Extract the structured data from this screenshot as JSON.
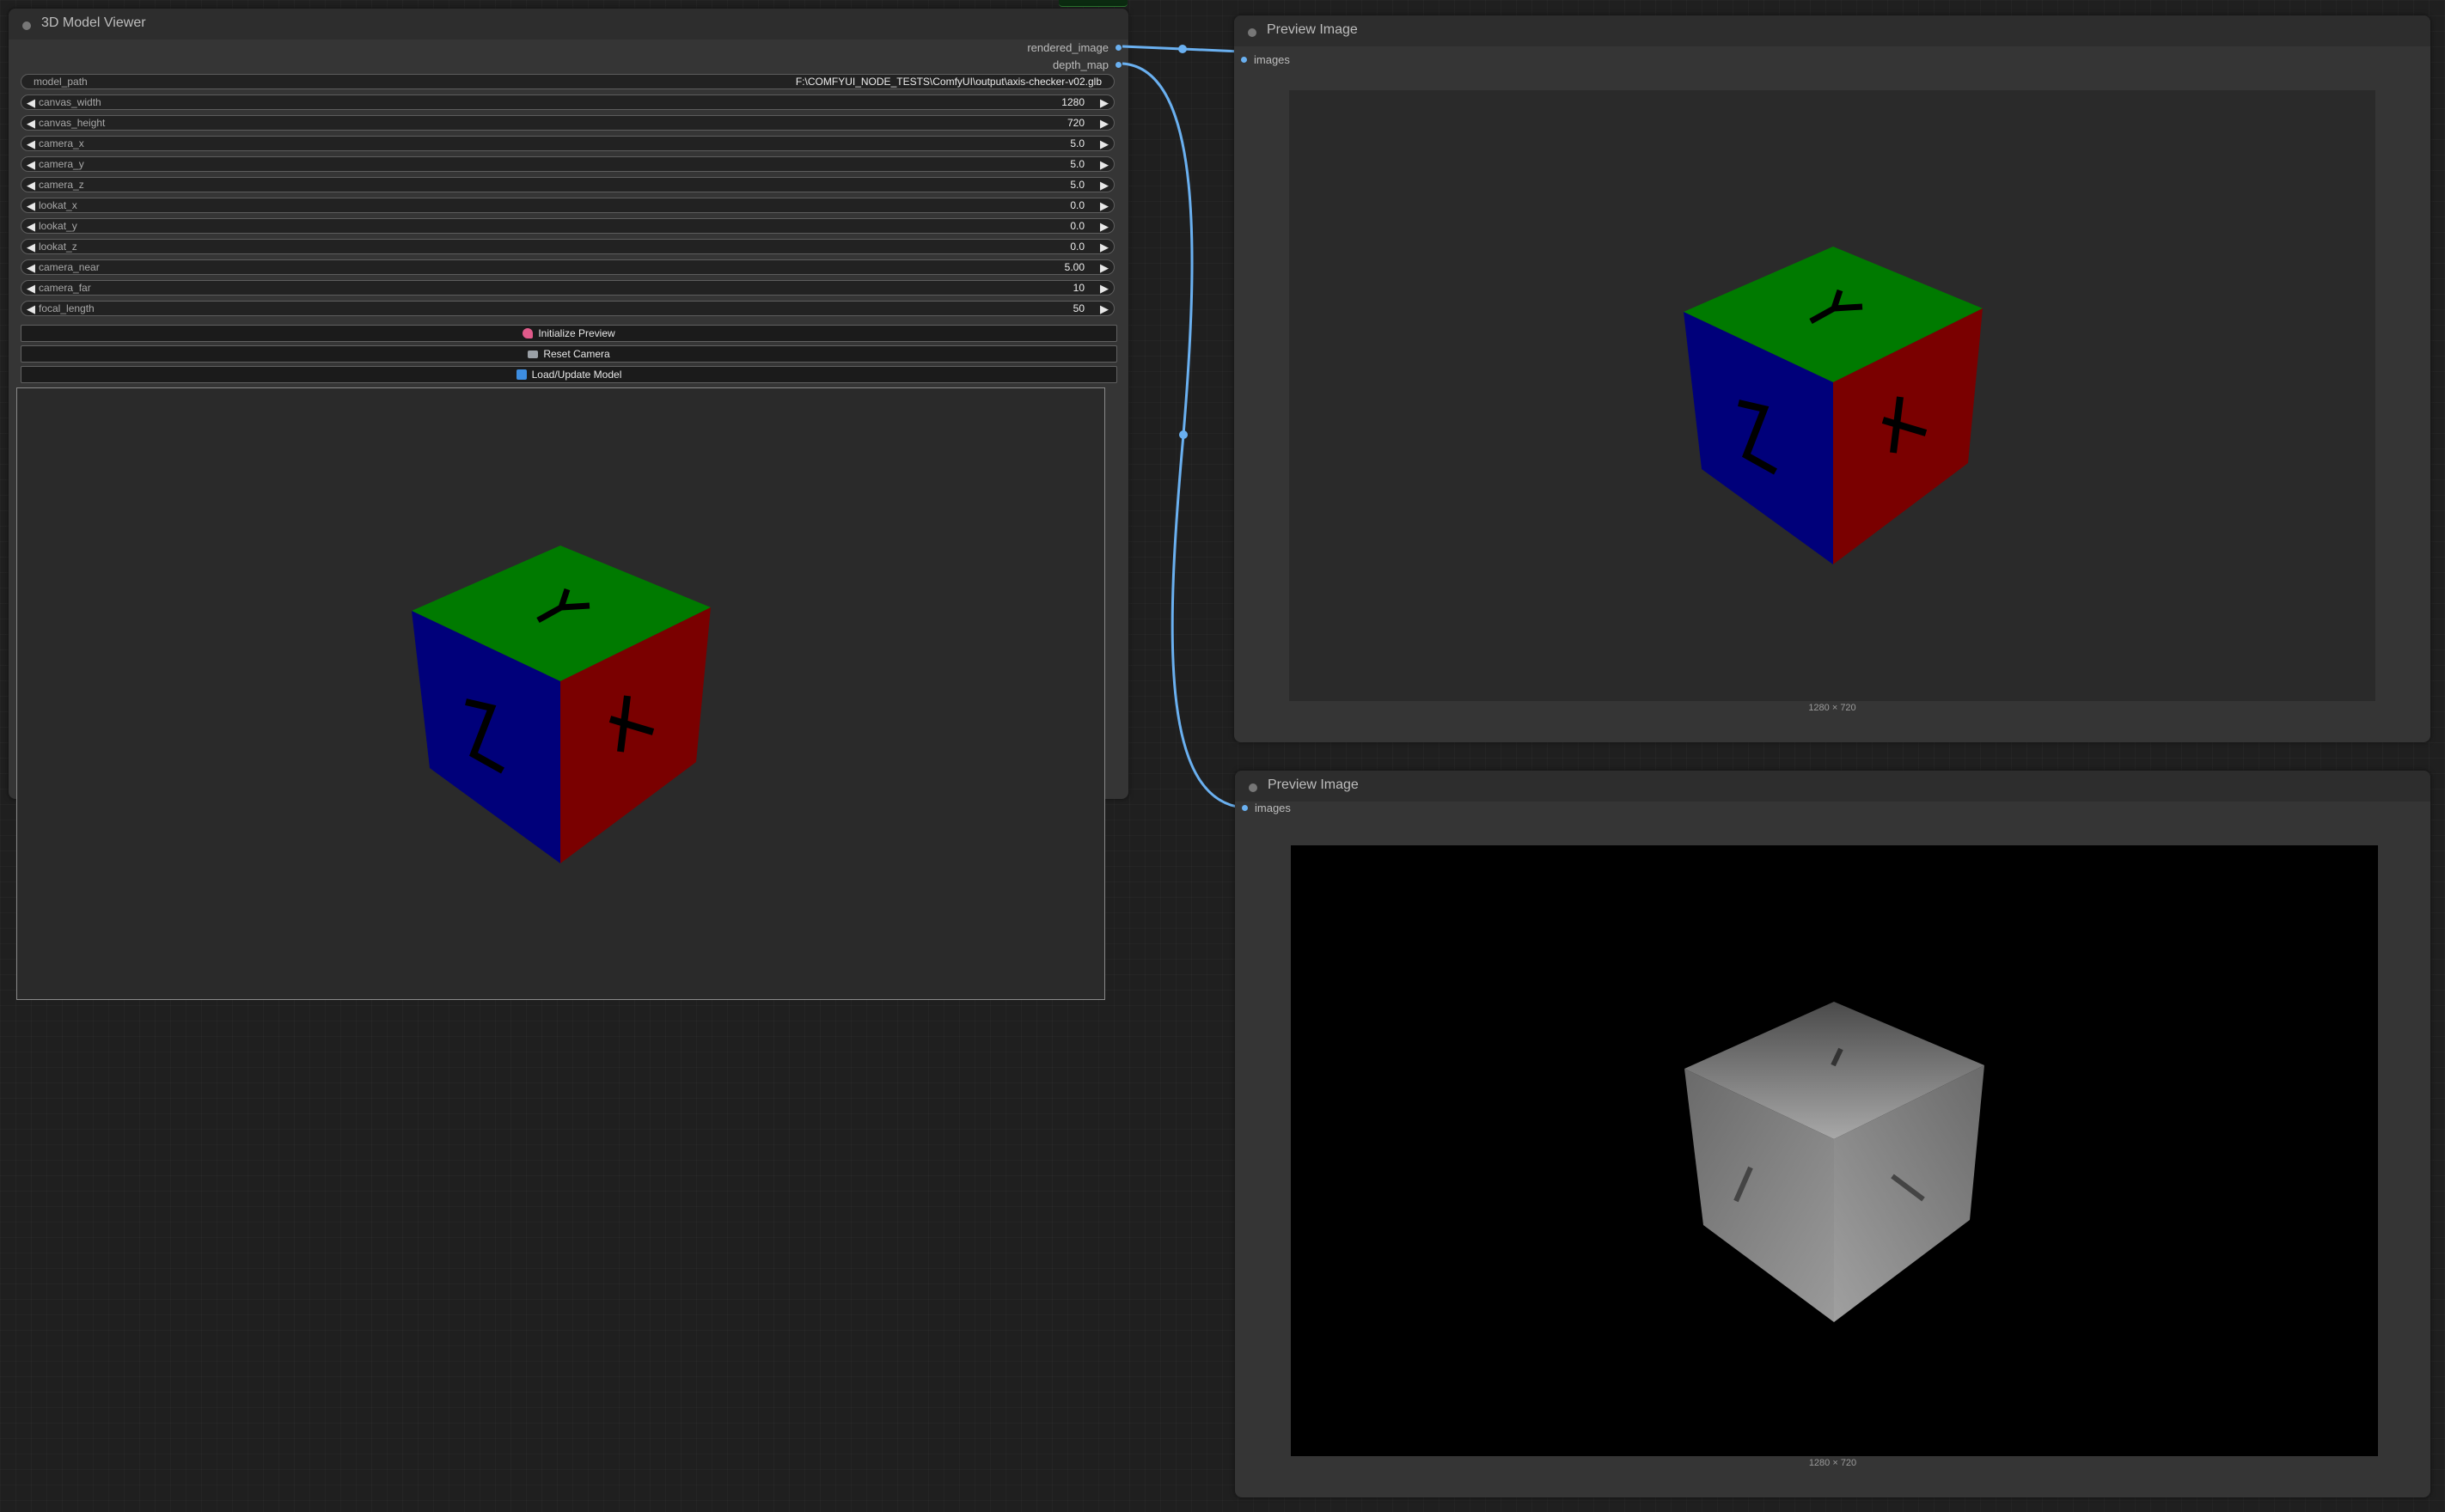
{
  "viewer_node": {
    "title": "3D Model Viewer",
    "outputs": [
      "rendered_image",
      "depth_map"
    ],
    "model_path": {
      "name": "model_path",
      "value": "F:\\COMFYUI_NODE_TESTS\\ComfyUI\\output\\axis-checker-v02.glb"
    },
    "widgets": [
      {
        "name": "canvas_width",
        "value": "1280"
      },
      {
        "name": "canvas_height",
        "value": "720"
      },
      {
        "name": "camera_x",
        "value": "5.0"
      },
      {
        "name": "camera_y",
        "value": "5.0"
      },
      {
        "name": "camera_z",
        "value": "5.0"
      },
      {
        "name": "lookat_x",
        "value": "0.0"
      },
      {
        "name": "lookat_y",
        "value": "0.0"
      },
      {
        "name": "lookat_z",
        "value": "0.0"
      },
      {
        "name": "camera_near",
        "value": "5.00"
      },
      {
        "name": "camera_far",
        "value": "10"
      },
      {
        "name": "focal_length",
        "value": "50"
      }
    ],
    "buttons": [
      {
        "label": "Initialize Preview",
        "icon": "rocket-icon",
        "color": "#e05a8a"
      },
      {
        "label": "Reset Camera",
        "icon": "camera-icon",
        "color": "#9aa0a6"
      },
      {
        "label": "Load/Update Model",
        "icon": "refresh-icon",
        "color": "#3d8de0"
      }
    ]
  },
  "preview_node_1": {
    "title": "Preview Image",
    "input": "images",
    "size_label": "1280 × 720"
  },
  "preview_node_2": {
    "title": "Preview Image",
    "input": "images",
    "size_label": "1280 × 720"
  },
  "colors": {
    "link": "#6ab0f0",
    "cube_top": "#007a00",
    "cube_left": "#00007a",
    "cube_right": "#7a0000"
  }
}
